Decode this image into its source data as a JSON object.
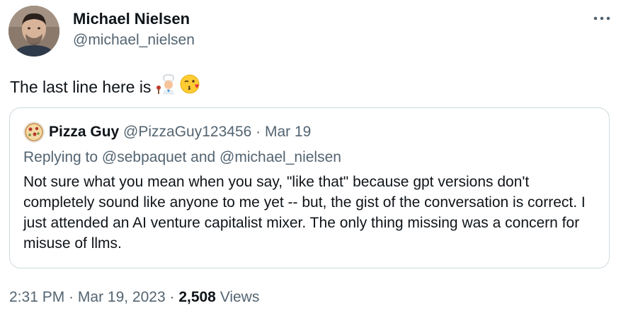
{
  "author": {
    "name": "Michael Nielsen",
    "handle": "@michael_nielsen"
  },
  "more_icon": "more-horizontal-icon",
  "tweet": {
    "text": "The last line here is",
    "emojis": [
      "chef-kiss-emoji",
      "kissing-face-emoji"
    ]
  },
  "quote": {
    "name": "Pizza Guy",
    "handle": "@PizzaGuy123456",
    "separator": "·",
    "date": "Mar 19",
    "replying_prefix": "Replying to ",
    "replying_user_1": "@sebpaquet",
    "replying_and": " and ",
    "replying_user_2": "@michael_nielsen",
    "body": "Not sure what you mean when you say, \"like that\" because gpt versions don't completely sound like anyone to me yet -- but, the gist of the conversation is correct. I just attended an AI venture capitalist mixer. The only thing missing was a concern for misuse of llms."
  },
  "meta": {
    "time": "2:31 PM",
    "sep1": " · ",
    "date": "Mar 19, 2023",
    "sep2": " · ",
    "views_count": "2,508",
    "views_label": " Views"
  },
  "colors": {
    "text_primary": "#0f1419",
    "text_secondary": "#536471",
    "border": "#cfd9de",
    "link": "#536471"
  }
}
